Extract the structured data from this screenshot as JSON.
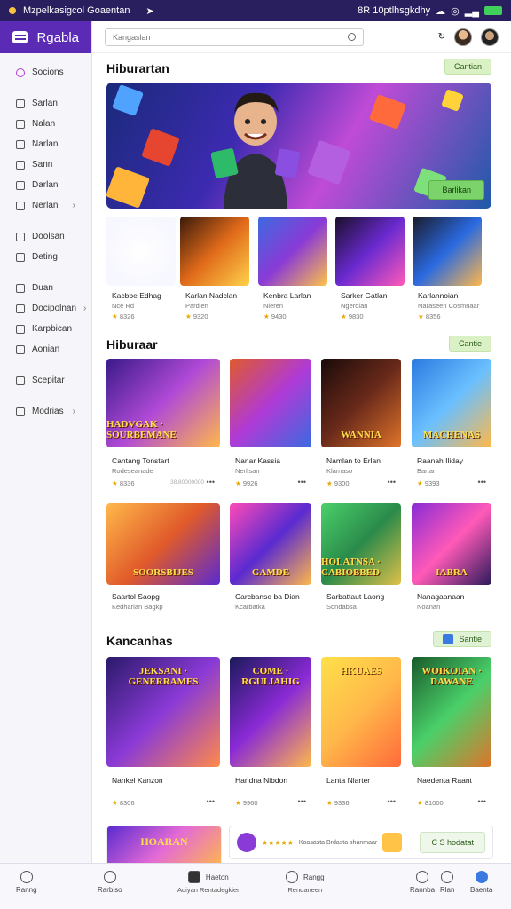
{
  "statusbar": {
    "left": "Mzpelkasigcol Goaentan",
    "right": "8R 10ptlhsgkdhy"
  },
  "brand": {
    "title": "Rgabla"
  },
  "search": {
    "placeholder": "Kangaslan"
  },
  "sidebar": {
    "items": [
      {
        "label": "Socions",
        "icon": "circle-icon"
      },
      {
        "label": "Sarlan",
        "icon": "square-icon"
      },
      {
        "label": "Nalan",
        "icon": "square-icon"
      },
      {
        "label": "Narlan",
        "icon": "play-icon"
      },
      {
        "label": "Sann",
        "icon": "square-icon"
      },
      {
        "label": "Darlan",
        "icon": "square-icon"
      },
      {
        "label": "Nerlan",
        "icon": "square-icon",
        "chevron": true
      },
      {
        "label": "Doolsan",
        "icon": "square-icon"
      },
      {
        "label": "Deting",
        "icon": "link-icon"
      },
      {
        "label": "Duan",
        "icon": "circle-icon"
      },
      {
        "label": "Docipolnan",
        "icon": "square-icon",
        "chevron": true
      },
      {
        "label": "Karpbican",
        "icon": "square-icon"
      },
      {
        "label": "Aonian",
        "icon": "square-icon"
      },
      {
        "label": "Scepitar",
        "icon": "square-icon"
      },
      {
        "label": "Modrias",
        "icon": "circle-icon",
        "chevron": true
      }
    ]
  },
  "section1": {
    "title": "Hiburartan",
    "pill": "Cantian",
    "hero_button": "Barlikan",
    "tiles": [
      {
        "name": "Kacbbe Edhag",
        "sub": "Nce Rd",
        "rating": "8326"
      },
      {
        "name": "Karlan Nadclan",
        "sub": "Pardlen",
        "rating": "9320"
      },
      {
        "name": "Kenbra Larlan",
        "sub": "Nleren",
        "rating": "9430"
      },
      {
        "name": "Sarker Gatlan",
        "sub": "Ngerdian",
        "rating": "9830"
      },
      {
        "name": "Karlannoian",
        "sub": "Naraseen Cosmnaar",
        "rating": "8356"
      }
    ]
  },
  "section2": {
    "title": "Hiburaar",
    "pill": "Cantie",
    "cards": [
      {
        "name": "Cantang Tonstart",
        "sub": "Rodeseanade",
        "rating": "8336",
        "extra": "38,80000000",
        "art": "HADVGAK · SOURBEMANE"
      },
      {
        "name": "Nanar Kassia",
        "sub": "Nerlisan",
        "rating": "9926",
        "art": ""
      },
      {
        "name": "Namlan to Erlan",
        "sub": "Klamaso",
        "rating": "9300",
        "art": "WANNIA"
      },
      {
        "name": "Raanah Iliday",
        "sub": "Bartar",
        "rating": "9393",
        "art": "MACHENAS"
      },
      {
        "name": "Saartol Saopg",
        "sub": "Kedharlan Bagkp",
        "art": "SOORSBIJES"
      },
      {
        "name": "Carcbanse ba Dian",
        "sub": "Kcarbatka",
        "art": "GAMDE"
      },
      {
        "name": "Sarbattaut Laong",
        "sub": "Sondabsa",
        "art": "HOLATNSA · CABIOBBED"
      },
      {
        "name": "Nanagaanaan",
        "sub": "Noanan",
        "art": "IABRA"
      }
    ]
  },
  "section3": {
    "title": "Kancanhas",
    "pill": "Santie",
    "cards": [
      {
        "name": "Nankel Kanzon",
        "rating": "8306",
        "art": "JEKSANI · GENERRAMES"
      },
      {
        "name": "Handna Nibdon",
        "rating": "9960",
        "art": "COME · RGULIAHIG"
      },
      {
        "name": "Lanta Nlarter",
        "rating": "9336",
        "art": "HKUAES"
      },
      {
        "name": "Naedenta Raant",
        "rating": "81000",
        "art": "WOIKOIAN · DAWANE"
      }
    ]
  },
  "bottom_partial": {
    "art": "HOARAN",
    "row_text": "Koasasta Brdasta shanmaar",
    "button": "C S hodatat"
  },
  "bottombar": {
    "items": [
      {
        "label": "Ranng",
        "icon": "home-icon"
      },
      {
        "label": "Rarbiso",
        "icon": "bell-icon"
      },
      {
        "label": "Haeton",
        "sub": "Adiyan Rentadegkier",
        "icon": "grid-icon"
      },
      {
        "label": "Rangg",
        "sub": "Rendaneen",
        "icon": "chat-icon"
      },
      {
        "label": "Rannba",
        "icon": "user-icon"
      },
      {
        "label": "Rlan",
        "icon": "play-icon"
      },
      {
        "label": "Baenta",
        "icon": "settings-icon"
      }
    ]
  }
}
